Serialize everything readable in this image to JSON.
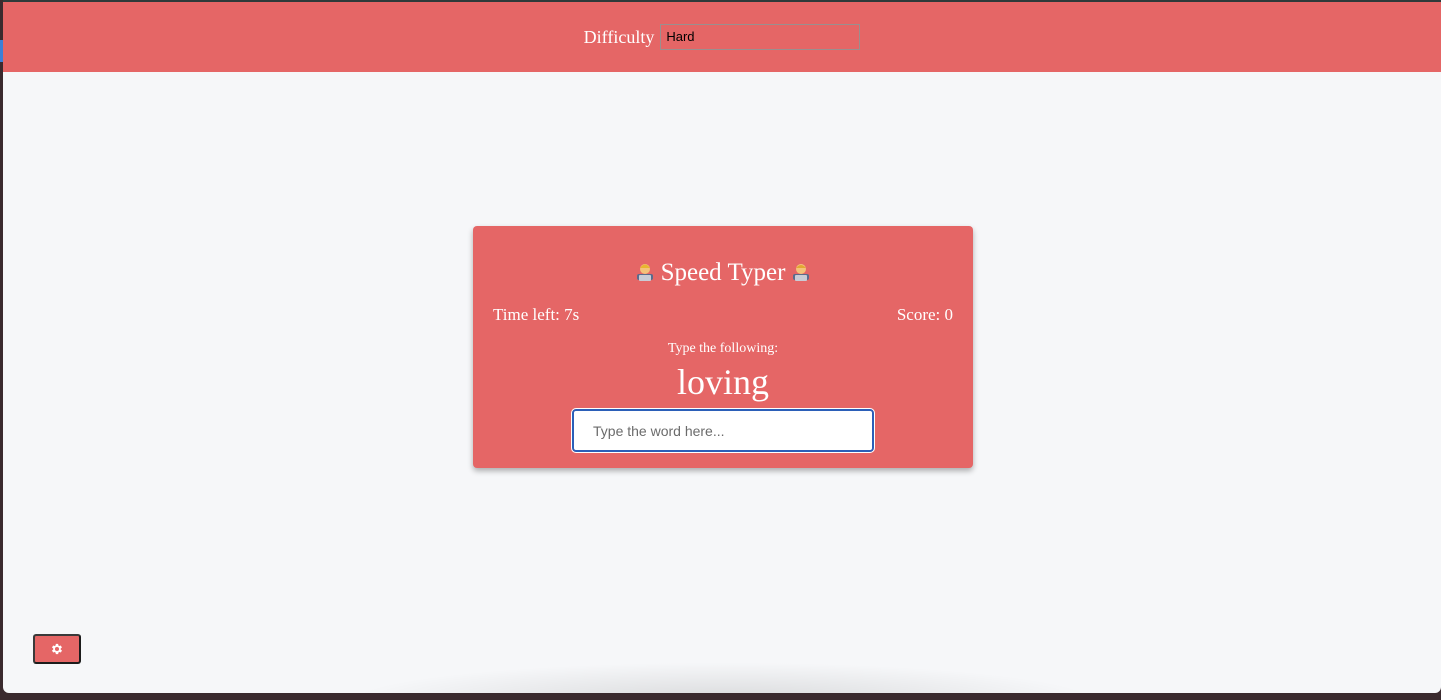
{
  "settings": {
    "difficulty_label": "Difficulty",
    "difficulty_value": "Hard"
  },
  "game": {
    "title": "Speed Typer",
    "title_icon": "technologist-emoji",
    "time_left": "Time left: 7s",
    "score": "Score: 0",
    "prompt_label": "Type the following:",
    "word": "loving",
    "input_placeholder": "Type the word here...",
    "input_value": ""
  },
  "settings_button": {
    "icon": "gear-icon"
  },
  "colors": {
    "accent": "#e56666",
    "background": "#f6f7f9",
    "input_border": "#2b5fb8"
  }
}
